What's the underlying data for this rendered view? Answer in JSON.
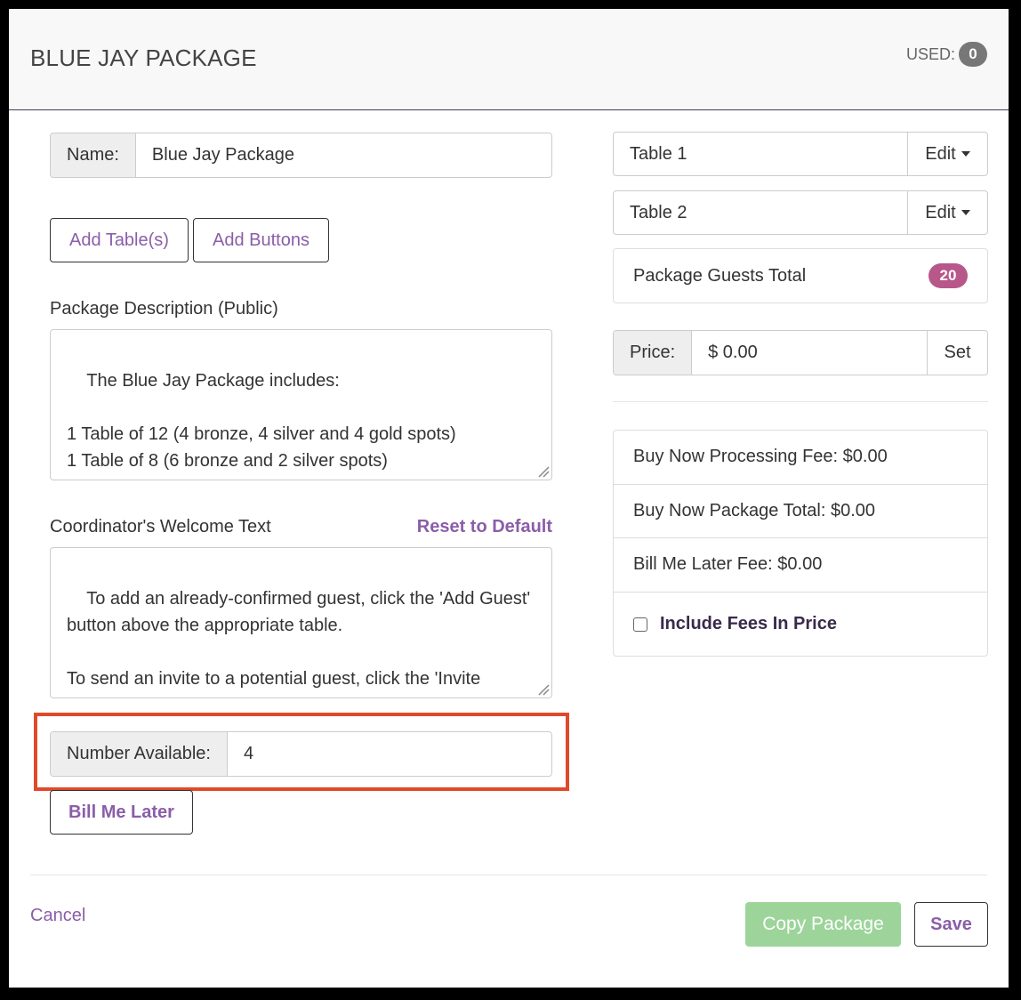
{
  "header": {
    "title": "BLUE JAY PACKAGE",
    "used_label": "USED:",
    "used_count": "0"
  },
  "name": {
    "label": "Name:",
    "value": "Blue Jay Package"
  },
  "buttons": {
    "add_tables": "Add Table(s)",
    "add_buttons": "Add Buttons",
    "bill_me_later": "Bill Me Later",
    "cancel": "Cancel",
    "copy_package": "Copy Package",
    "save": "Save",
    "reset_to_default": "Reset to Default"
  },
  "description": {
    "label": "Package Description (Public)",
    "value": "The Blue Jay Package includes:\n\n1 Table of 12 (4 bronze, 4 silver and 4 gold spots)\n1 Table of 8 (6 bronze and 2 silver spots)"
  },
  "welcome": {
    "label": "Coordinator's Welcome Text",
    "value": "To add an already-confirmed guest, click the 'Add Guest' button above the appropriate table.\n\nTo send an invite to a potential guest, click the 'Invite Guest' button above the appropriate table. The guest will receive an invite email for you to track your guests' responses."
  },
  "number_available": {
    "label": "Number Available:",
    "value": "4"
  },
  "tables": [
    {
      "name": "Table 1",
      "edit_label": "Edit"
    },
    {
      "name": "Table 2",
      "edit_label": "Edit"
    }
  ],
  "guests_total": {
    "label": "Package Guests Total",
    "count": "20"
  },
  "price": {
    "label": "Price:",
    "value": "$ 0.00",
    "set_label": "Set"
  },
  "fees": {
    "processing": "Buy Now Processing Fee: $0.00",
    "package_total": "Buy Now Package Total: $0.00",
    "bill_later": "Bill Me Later Fee: $0.00",
    "include_label": "Include Fees In Price"
  },
  "colors": {
    "accent": "#8a5ea8",
    "badge_pink": "#b8578a",
    "highlight": "#e04a2a",
    "copy_green": "#9dd49a"
  }
}
